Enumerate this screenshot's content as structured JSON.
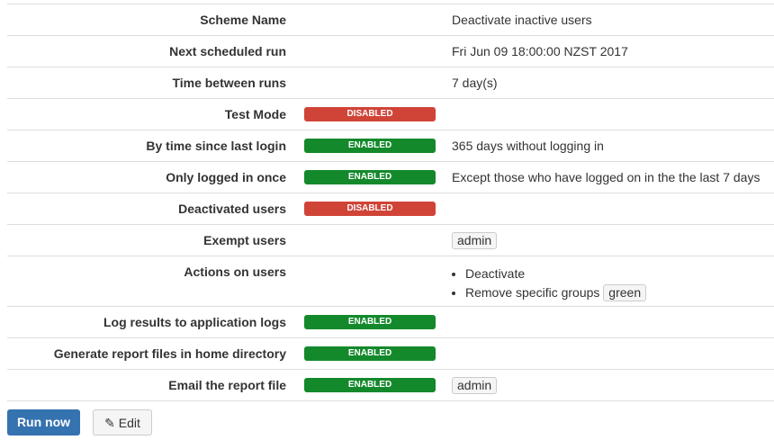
{
  "rows": [
    {
      "label": "Scheme Name",
      "value": "Deactivate inactive users"
    },
    {
      "label": "Next scheduled run",
      "value": "Fri Jun 09 18:00:00 NZST 2017"
    },
    {
      "label": "Time between runs",
      "value": "7 day(s)"
    },
    {
      "label": "Test Mode",
      "status": "DISABLED"
    },
    {
      "label": "By time since last login",
      "status": "ENABLED",
      "value": "365 days without logging in"
    },
    {
      "label": "Only logged in once",
      "status": "ENABLED",
      "value": "Except those who have logged on in the the last 7 days"
    },
    {
      "label": "Deactivated users",
      "status": "DISABLED"
    },
    {
      "label": "Exempt users",
      "tag": "admin"
    },
    {
      "label": "Actions on users",
      "actions": [
        "Deactivate",
        "Remove specific groups"
      ],
      "action_tag": "green"
    },
    {
      "label": "Log results to application logs",
      "status": "ENABLED"
    },
    {
      "label": "Generate report files in home directory",
      "status": "ENABLED"
    },
    {
      "label": "Email the report file",
      "status": "ENABLED",
      "tag": "admin"
    }
  ],
  "buttons": {
    "run": "Run now",
    "edit": "Edit"
  },
  "colors": {
    "enabled": "#14892c",
    "disabled": "#d04437",
    "primary": "#3572b0"
  }
}
